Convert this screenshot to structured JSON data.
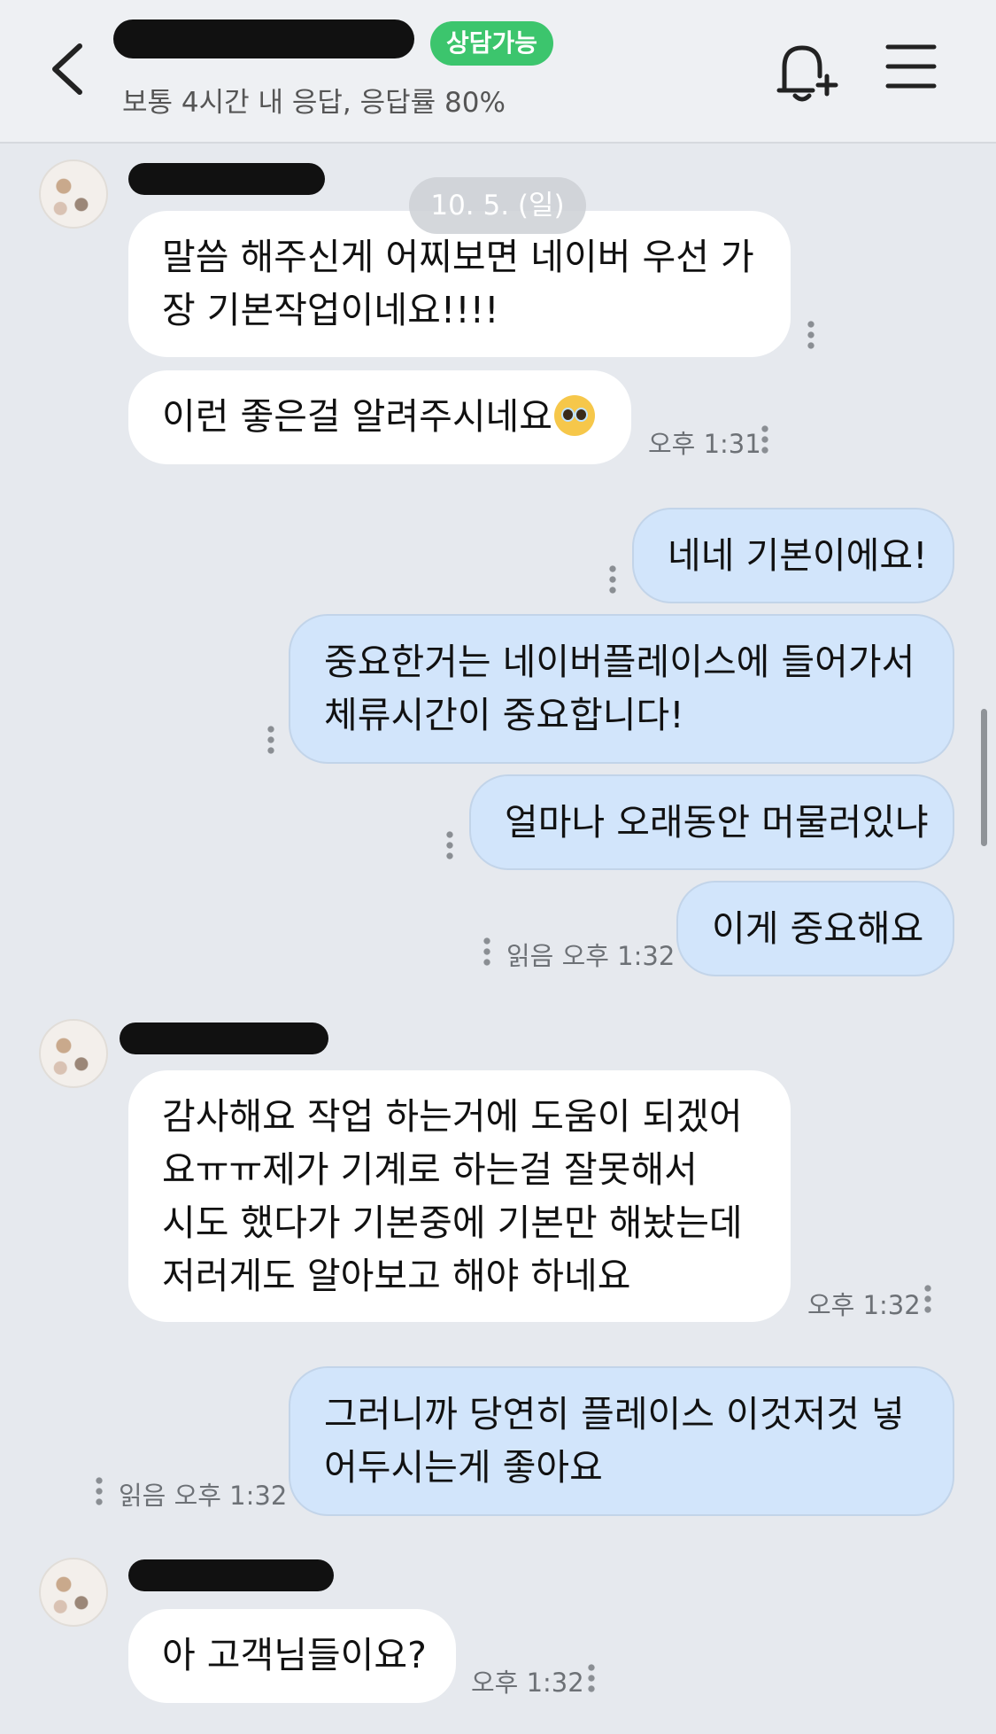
{
  "header": {
    "status_badge": "상담가능",
    "subtitle": "보통 4시간 내 응답, 응답률 80%"
  },
  "date_divider": "10. 5. (일)",
  "messages": {
    "m1_l1": "말씀 해주신게 어찌보면 네이버 우선 가",
    "m1_l2": "장 기본작업이네요!!!!",
    "m2": "이런 좋은걸 알려주시네요",
    "m2_time": "오후 1:31",
    "m3": "네네 기본이에요!",
    "m4_l1": "중요한거는 네이버플레이스에 들어가서",
    "m4_l2": "체류시간이 중요합니다!",
    "m5": "얼마나 오래동안 머물러있냐",
    "m6": "이게 중요해요",
    "m6_meta": "읽음 오후 1:32",
    "m7_l1": "감사해요 작업 하는거에 도움이 되겠어",
    "m7_l2": "요ㅠㅠ제가 기계로 하는걸 잘못해서",
    "m7_l3": "시도 했다가 기본중에 기본만 해놨는데",
    "m7_l4": "저러게도 알아보고 해야 하네요",
    "m7_time": "오후 1:32",
    "m8_l1": "그러니까 당연히 플레이스 이것저것 넣",
    "m8_l2": "어두시는게 좋아요",
    "m8_meta": "읽음 오후 1:32",
    "m9": "아 고객님들이요?",
    "m9_time": "오후 1:32"
  },
  "icons": {
    "back": "chevron-left-icon",
    "bell": "bell-plus-icon",
    "menu": "hamburger-menu-icon",
    "emoji": "pleading-face-emoji"
  },
  "colors": {
    "badge": "#3cc56d",
    "incoming_bubble": "#ffffff",
    "outgoing_bubble": "#d2e5fb",
    "background": "#e6e9ee"
  }
}
